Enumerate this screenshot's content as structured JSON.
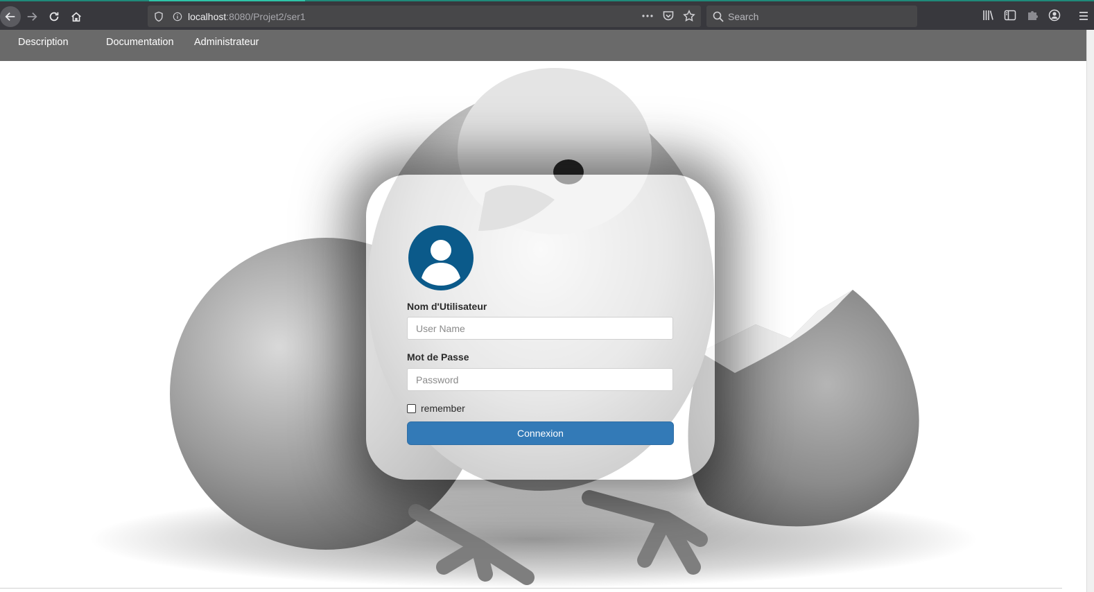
{
  "browser": {
    "url_host": "localhost",
    "url_rest": ":8080/Projet2/ser1",
    "search_placeholder": "Search",
    "icons": [
      "back-icon",
      "forward-icon",
      "reload-icon",
      "home-icon",
      "shield-icon",
      "info-icon",
      "more-icon",
      "pocket-icon",
      "star-icon",
      "search-icon",
      "library-icon",
      "sidebar-icon",
      "extension-icon",
      "account-icon",
      "menu-icon"
    ]
  },
  "nav": {
    "items": [
      {
        "label": "Description"
      },
      {
        "label": "Documentation"
      },
      {
        "label": "Administrateur"
      }
    ]
  },
  "login": {
    "username_label": "Nom d'Utilisateur",
    "username_placeholder": "User Name",
    "password_label": "Mot de Passe",
    "password_placeholder": "Password",
    "remember_label": "remember",
    "remember_checked": false,
    "submit_label": "Connexion",
    "avatar_icon": "user-icon",
    "avatar_color": "#0b5a8a",
    "button_color": "#337ab7"
  }
}
